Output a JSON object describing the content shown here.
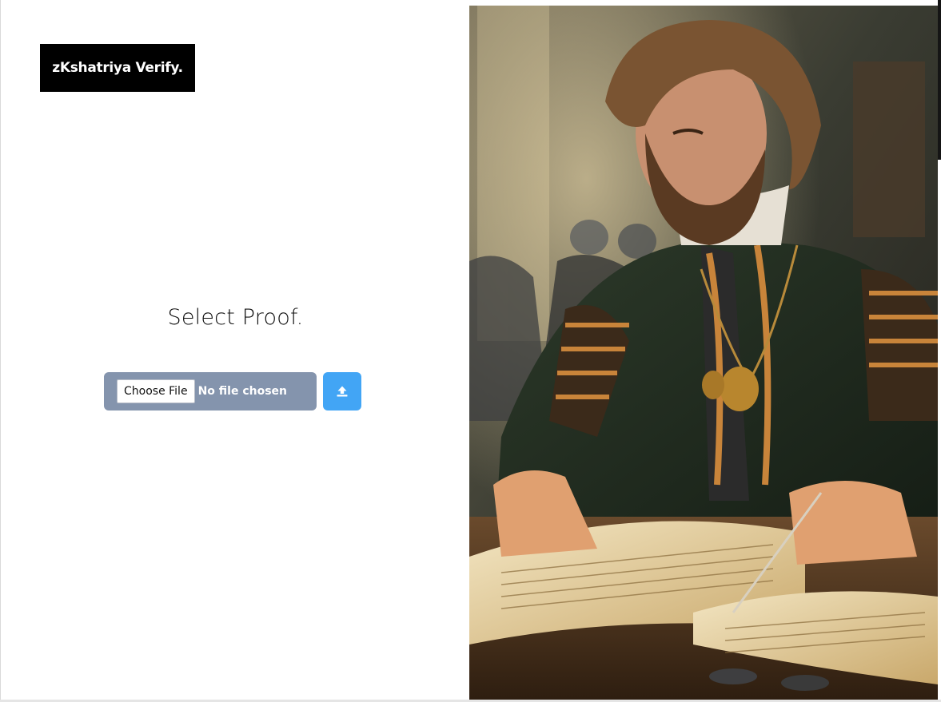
{
  "brand": {
    "label": "zKshatriya Verify."
  },
  "proof": {
    "title": "Select Proof.",
    "choose_file_label": "Choose File",
    "file_status": "No file chosen",
    "upload_icon": "upload-icon"
  },
  "hero_image": {
    "subject": "medieval-noble-scribe-painting"
  },
  "colors": {
    "brand_bg": "#000000",
    "file_input_bg": "#8494ad",
    "upload_button_bg": "#42a5f5"
  }
}
